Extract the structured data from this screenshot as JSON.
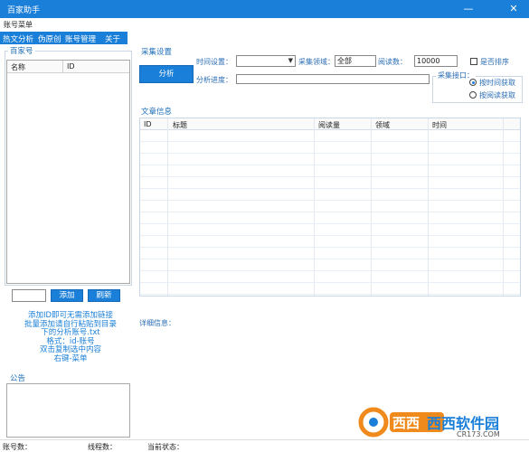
{
  "window": {
    "title": "百家助手"
  },
  "menubar": {
    "account_menu": "账号菜单"
  },
  "tabs": [
    "热文分析",
    "伪原创",
    "账号管理",
    "关于"
  ],
  "left": {
    "account_group": "百家号",
    "columns": {
      "name": "名称",
      "id": "ID"
    },
    "add_input_value": "",
    "add_button": "添加",
    "refresh_button": "刷新",
    "instructions": [
      "添加ID即可无需添加链接",
      "批量添加请自行粘贴到目录",
      "下的分析账号.txt",
      "格式：id-账号",
      "双击复制选中内容",
      "右键-菜单"
    ],
    "notice_group": "公告"
  },
  "collect": {
    "group_label": "采集设置",
    "analyze_button": "分析",
    "time_label": "时间设置：",
    "time_value": "",
    "domain_label": "采集领域：",
    "domain_value": "全部",
    "reads_label": "阅读数：",
    "reads_value": "10000",
    "sort_label": "是否排序",
    "progress_label": "分析进度：",
    "interface_label": "采集接口：",
    "radio_time": "按时间获取",
    "radio_reads": "按阅读获取"
  },
  "articles": {
    "group_label": "文章信息",
    "columns": [
      "ID",
      "标题",
      "阅读量",
      "领域",
      "时间"
    ],
    "rows": []
  },
  "detail": {
    "label": "详细信息："
  },
  "status": {
    "accounts_label": "账号数：",
    "threads_label": "线程数：",
    "state_label": "当前状态："
  },
  "watermark": {
    "brand": "西西软件园",
    "url": "CR173.COM"
  },
  "colors": {
    "accent": "#1a7fd8",
    "orange": "#f08a1c"
  }
}
